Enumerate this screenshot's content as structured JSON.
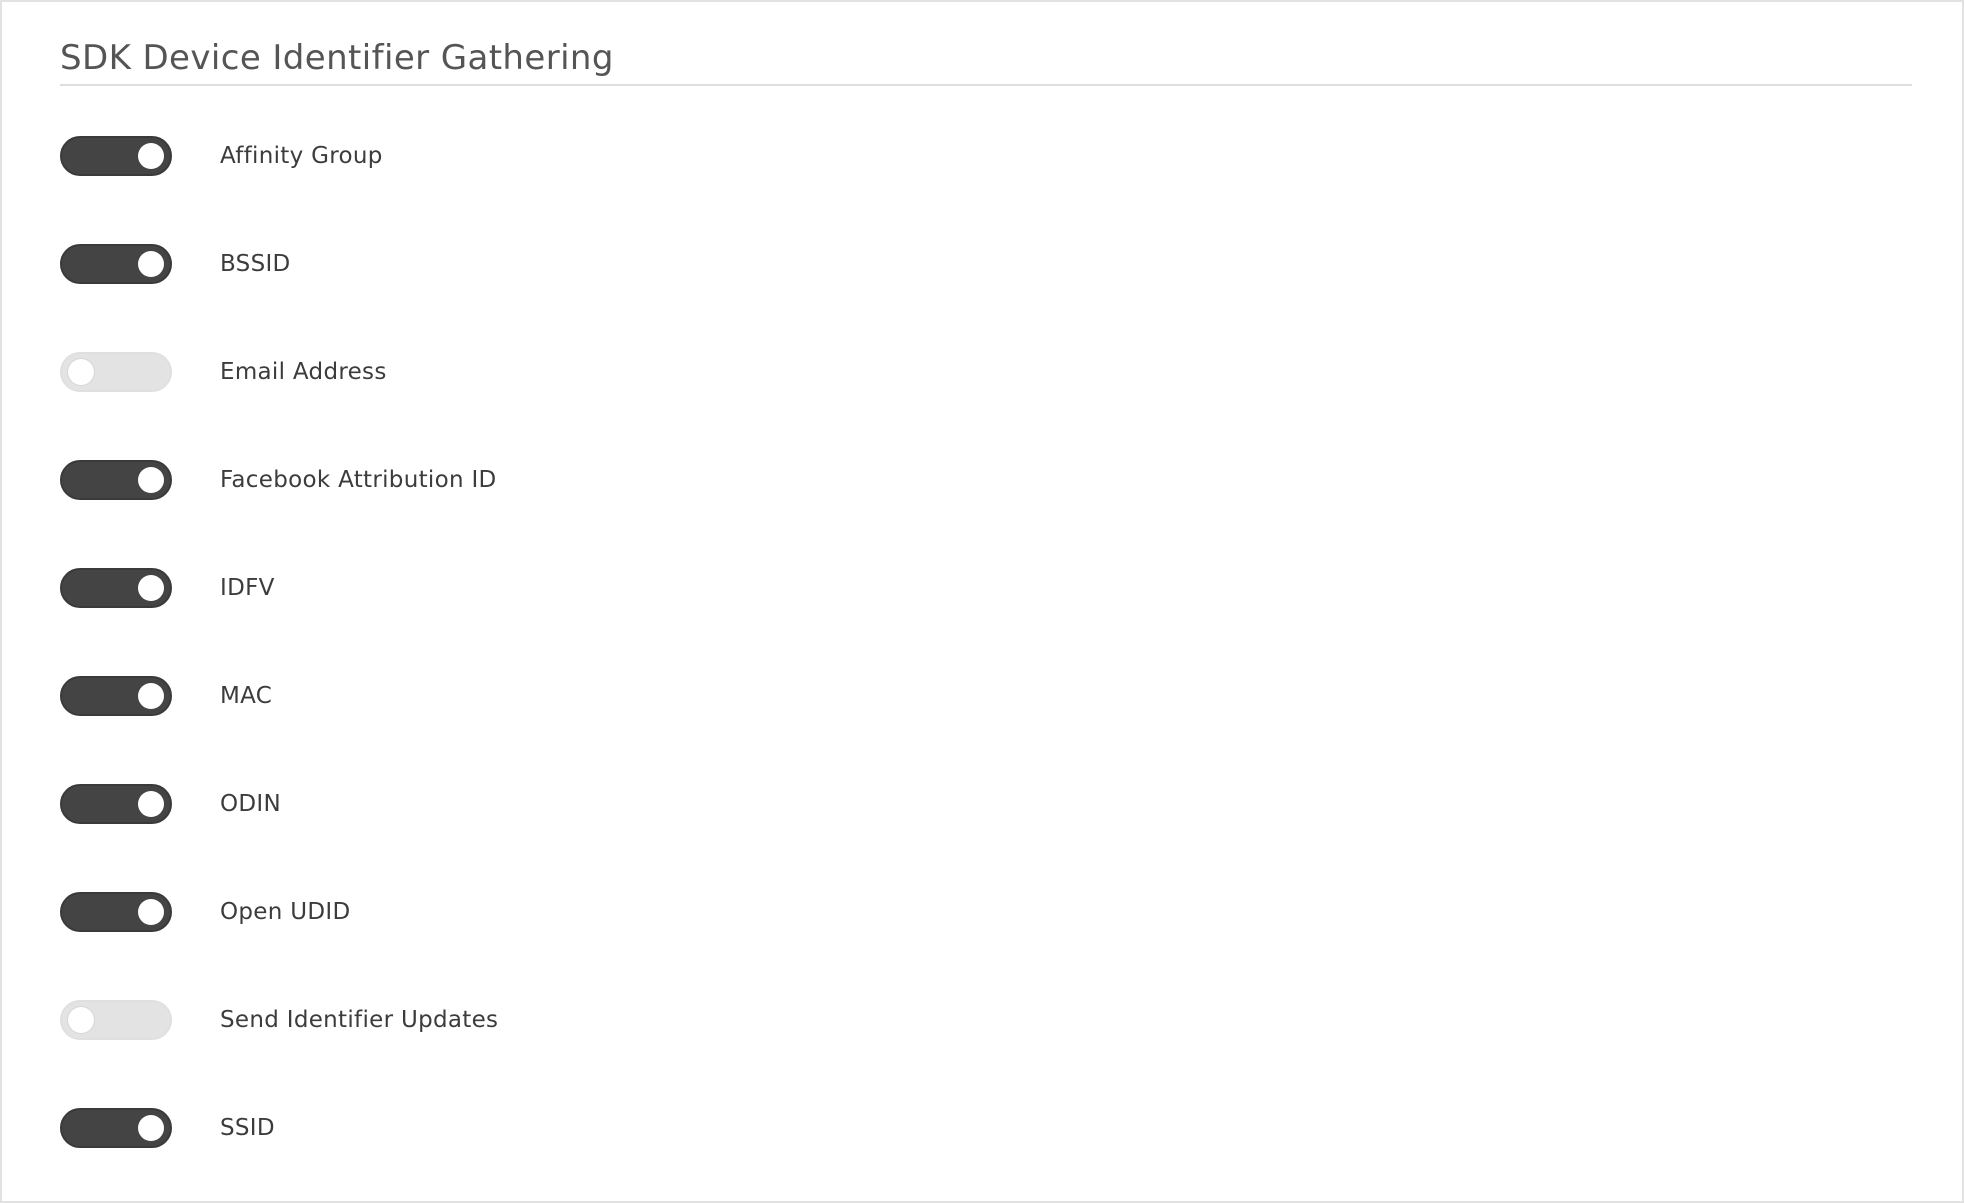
{
  "section": {
    "title": "SDK Device Identifier Gathering"
  },
  "settings": [
    {
      "label": "Affinity Group",
      "enabled": true
    },
    {
      "label": "BSSID",
      "enabled": true
    },
    {
      "label": "Email Address",
      "enabled": false
    },
    {
      "label": "Facebook Attribution ID",
      "enabled": true
    },
    {
      "label": "IDFV",
      "enabled": true
    },
    {
      "label": "MAC",
      "enabled": true
    },
    {
      "label": "ODIN",
      "enabled": true
    },
    {
      "label": "Open UDID",
      "enabled": true
    },
    {
      "label": "Send Identifier Updates",
      "enabled": false
    },
    {
      "label": "SSID",
      "enabled": true
    }
  ],
  "colors": {
    "toggle_on": "#444444",
    "toggle_off": "#e3e3e3",
    "knob": "#ffffff",
    "divider": "#dedede"
  }
}
